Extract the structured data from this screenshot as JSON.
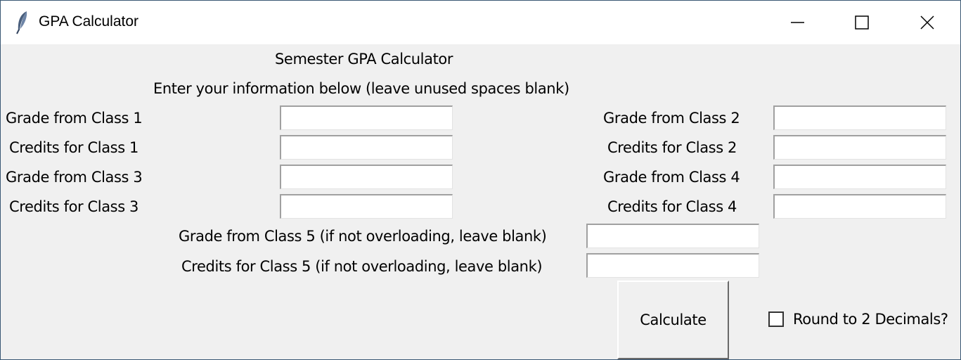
{
  "window": {
    "title": "GPA Calculator",
    "icon": "feather-icon",
    "controls": [
      "minimize-icon",
      "maximize-icon",
      "close-icon"
    ]
  },
  "header": {
    "title": "Semester GPA Calculator",
    "instructions": "Enter your information below (leave unused spaces blank)"
  },
  "fields": {
    "grade1": {
      "label": "Grade from Class 1",
      "value": ""
    },
    "credits1": {
      "label": "Credits for Class 1",
      "value": ""
    },
    "grade2": {
      "label": "Grade from Class 2",
      "value": ""
    },
    "credits2": {
      "label": "Credits for Class 2",
      "value": ""
    },
    "grade3": {
      "label": "Grade from Class 3",
      "value": ""
    },
    "credits3": {
      "label": "Credits for Class 3",
      "value": ""
    },
    "grade4": {
      "label": "Grade from Class 4",
      "value": ""
    },
    "credits4": {
      "label": "Credits for Class 4",
      "value": ""
    },
    "grade5": {
      "label": "Grade from Class 5 (if not overloading, leave blank)",
      "value": ""
    },
    "credits5": {
      "label": "Credits for Class 5 (if not overloading, leave blank)",
      "value": ""
    }
  },
  "actions": {
    "calculate_label": "Calculate",
    "round_label": "Round to 2 Decimals?",
    "round_checked": false
  }
}
